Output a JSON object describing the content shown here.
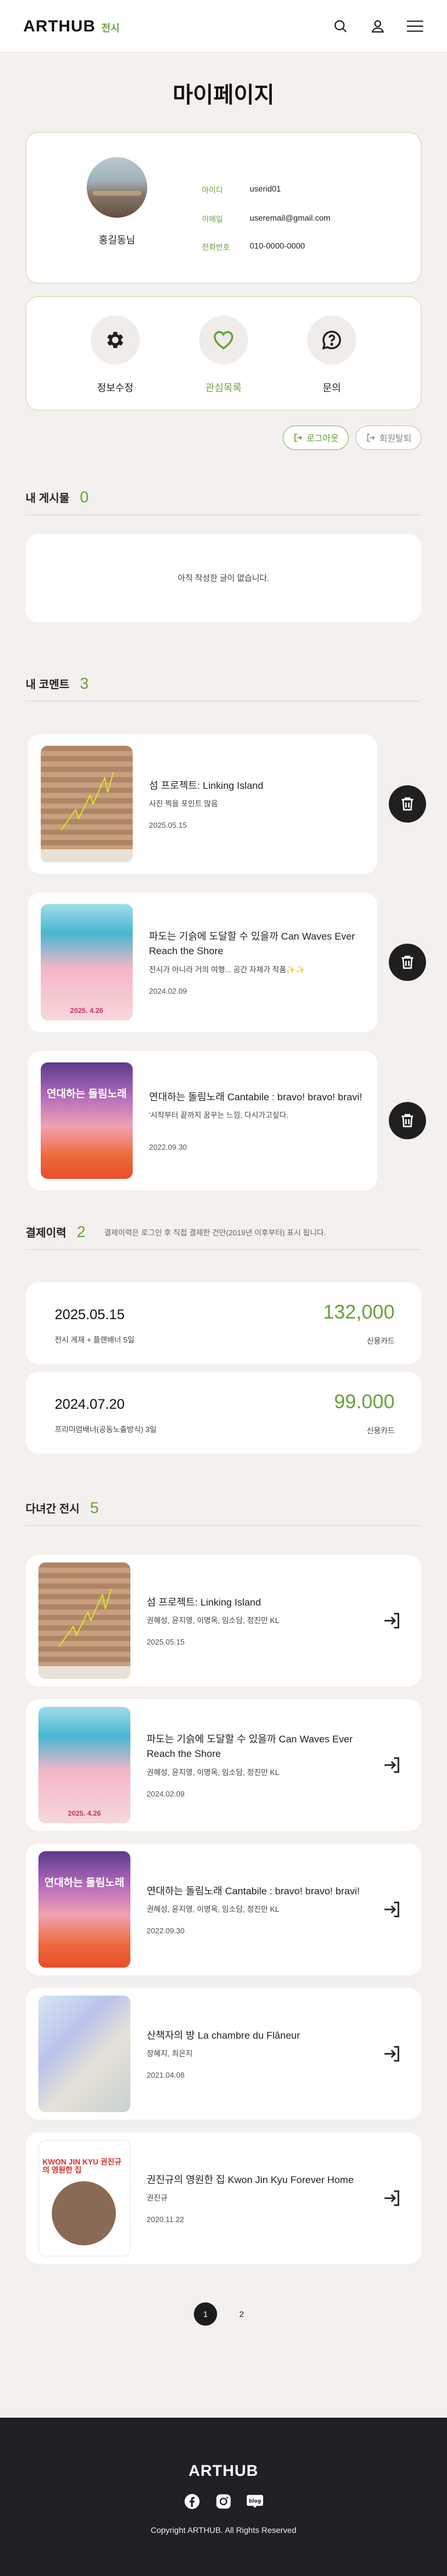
{
  "header": {
    "logo": "ARTHUB",
    "logo_sub": "전시",
    "icons": [
      "search-icon",
      "user-icon",
      "menu-icon"
    ]
  },
  "page_title": "마이페이지",
  "profile": {
    "name": "홍길동님",
    "fields": [
      {
        "label": "아이디",
        "value": "userid01"
      },
      {
        "label": "이메일",
        "value": "useremail@gmail.com"
      },
      {
        "label": "전화번호",
        "value": "010-0000-0000"
      }
    ]
  },
  "actions": [
    {
      "label": "정보수정",
      "icon": "gear-icon"
    },
    {
      "label": "관심목록",
      "icon": "heart-icon"
    },
    {
      "label": "문의",
      "icon": "question-chat-icon"
    }
  ],
  "buttons": {
    "logout": "로그아웃",
    "withdraw": "회원탈퇴"
  },
  "posts": {
    "title": "내 게시물",
    "count": "0",
    "empty": "아직 작성한 글이 없습니다."
  },
  "comments": {
    "title": "내 코멘트",
    "count": "3",
    "items": [
      {
        "title": "섬 프로젝트: Linking Island",
        "text": "사진 찍을 포인트 많음",
        "date": "2025.05.15"
      },
      {
        "title": "파도는 기슭에 도달할 수 있을까 Can Waves Ever Reach the Shore",
        "text": "전시가 아니라 거의 여행... 공간 자체가 작품✨✨",
        "date": "2024.02.09"
      },
      {
        "title": "연대하는 돌림노래 Cantabile : bravo! bravo! bravi!",
        "text": "'시작부터 끝까지 꿈꾸는 느낌, 다시가고싶다.",
        "date": "2022.09.30"
      }
    ]
  },
  "payments": {
    "title": "결제이력",
    "count": "2",
    "note": "결제이력은 로그인 후 직접 결제한 건만(2019년 이후부터) 표시 됩니다.",
    "items": [
      {
        "date": "2025.05.15",
        "desc": "전시 게재 + 플랜배너 5일",
        "amount": "132,000",
        "method": "신용카드"
      },
      {
        "date": "2024.07.20",
        "desc": "프리미엄배너(공동노출방식) 3일",
        "amount": "99.000",
        "method": "신용카드"
      }
    ]
  },
  "visited": {
    "title": "다녀간 전시",
    "count": "5",
    "items": [
      {
        "title": "섬 프로젝트: Linking Island",
        "artists": "권혜성, 윤지영, 이명옥, 임소담, 정진만 KL",
        "date": "2025.05.15"
      },
      {
        "title": "파도는 기슭에 도달할 수 있을까 Can Waves Ever Reach the Shore",
        "artists": "권혜성, 윤지영, 이명옥, 임소담, 정진만 KL",
        "date": "2024.02.09"
      },
      {
        "title": "연대하는 돌림노래 Cantabile : bravo! bravo! bravi!",
        "artists": "권혜성, 윤지영, 이명옥, 임소담, 정진만 KL",
        "date": "2022.09.30"
      },
      {
        "title": "산책자의 방 La chambre du Flâneur",
        "artists": "장혜지, 최은지",
        "date": "2021.04.08"
      },
      {
        "title": "권진규의 영원한 집 Kwon Jin Kyu Forever Home",
        "artists": "권진규",
        "date": "2020.11.22"
      }
    ]
  },
  "thumb_texts": {
    "t2": "2025. 4.26",
    "t3": "연대하는 돌림노래",
    "t5": "KWON JIN KYU 권진규의 영원한 집"
  },
  "pagination": {
    "pages": [
      "1",
      "2"
    ],
    "current": "1"
  },
  "footer": {
    "logo": "ARTHUB",
    "icons": [
      "facebook-icon",
      "instagram-icon",
      "blog-icon"
    ],
    "blog_label": "blog",
    "copyright": "Copyright ARTHUB. All Rights Reserved"
  },
  "colors": {
    "accent": "#6aa03a",
    "background": "#f4f0ee",
    "footer": "#1e2023"
  }
}
